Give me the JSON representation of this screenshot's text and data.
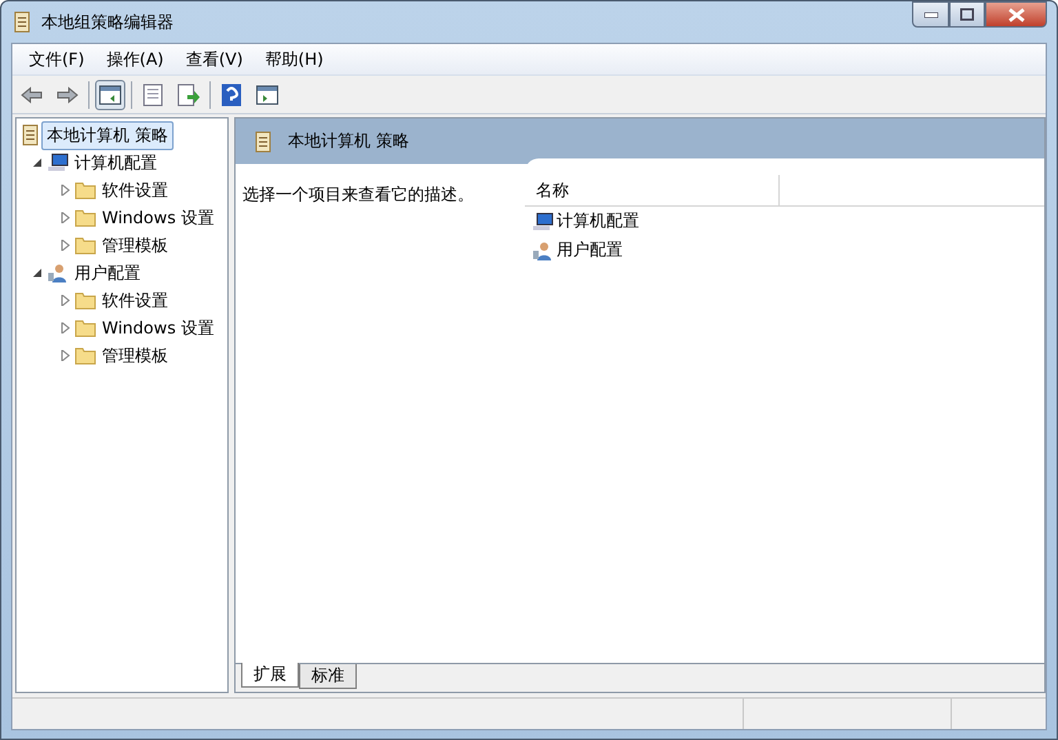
{
  "window": {
    "title": "本地组策略编辑器"
  },
  "menu": [
    "文件(F)",
    "操作(A)",
    "查看(V)",
    "帮助(H)"
  ],
  "tree": {
    "label": "本地计算机 策略",
    "selected": true,
    "children": [
      {
        "label": "计算机配置",
        "kind": "computer",
        "expanded": true,
        "selected": false,
        "children": [
          {
            "label": "软件设置",
            "kind": "folder",
            "expanded": false,
            "selected": false
          },
          {
            "label": "Windows 设置",
            "kind": "folder",
            "expanded": false,
            "selected": false
          },
          {
            "label": "管理模板",
            "kind": "folder",
            "expanded": false,
            "selected": false
          }
        ]
      },
      {
        "label": "用户配置",
        "kind": "user",
        "expanded": true,
        "selected": false,
        "children": [
          {
            "label": "软件设置",
            "kind": "folder",
            "expanded": false,
            "selected": false
          },
          {
            "label": "Windows 设置",
            "kind": "folder",
            "expanded": false,
            "selected": false
          },
          {
            "label": "管理模板",
            "kind": "folder",
            "expanded": false,
            "selected": false
          }
        ]
      }
    ]
  },
  "detail": {
    "title": "本地计算机 策略",
    "description": "选择一个项目来查看它的描述。",
    "columns": [
      "名称"
    ],
    "items": [
      {
        "label": "计算机配置",
        "kind": "computer"
      },
      {
        "label": "用户配置",
        "kind": "user"
      }
    ]
  },
  "tabs": [
    {
      "label": "扩展",
      "selected": true
    },
    {
      "label": "标准",
      "selected": false
    }
  ]
}
